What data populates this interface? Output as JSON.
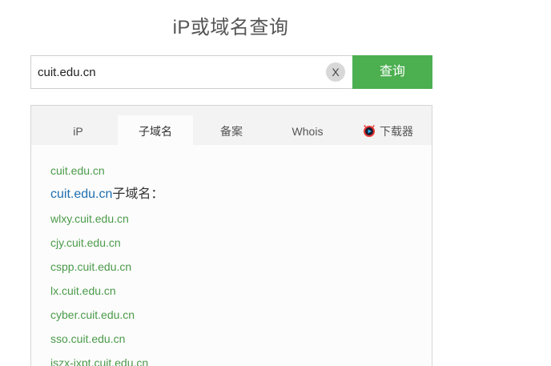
{
  "page": {
    "title": "iP或域名查询"
  },
  "search": {
    "value": "cuit.edu.cn",
    "clear_label": "X",
    "button_label": "查询"
  },
  "tabs": [
    {
      "label": "iP",
      "active": false
    },
    {
      "label": "子域名",
      "active": true
    },
    {
      "label": "备案",
      "active": false
    },
    {
      "label": "Whois",
      "active": false
    },
    {
      "label": "下载器",
      "active": false,
      "icon": "downloader-app-icon"
    }
  ],
  "results": {
    "domain": "cuit.edu.cn",
    "heading_domain": "cuit.edu.cn",
    "heading_suffix": "子域名：",
    "subdomains": [
      "wlxy.cuit.edu.cn",
      "cjy.cuit.edu.cn",
      "cspp.cuit.edu.cn",
      "lx.cuit.edu.cn",
      "cyber.cuit.edu.cn",
      "sso.cuit.edu.cn",
      "jszx-jxpt.cuit.edu.cn"
    ]
  },
  "colors": {
    "accent_green": "#4caf50",
    "link_green": "#4a9a4a",
    "heading_blue": "#1e6fb0"
  }
}
